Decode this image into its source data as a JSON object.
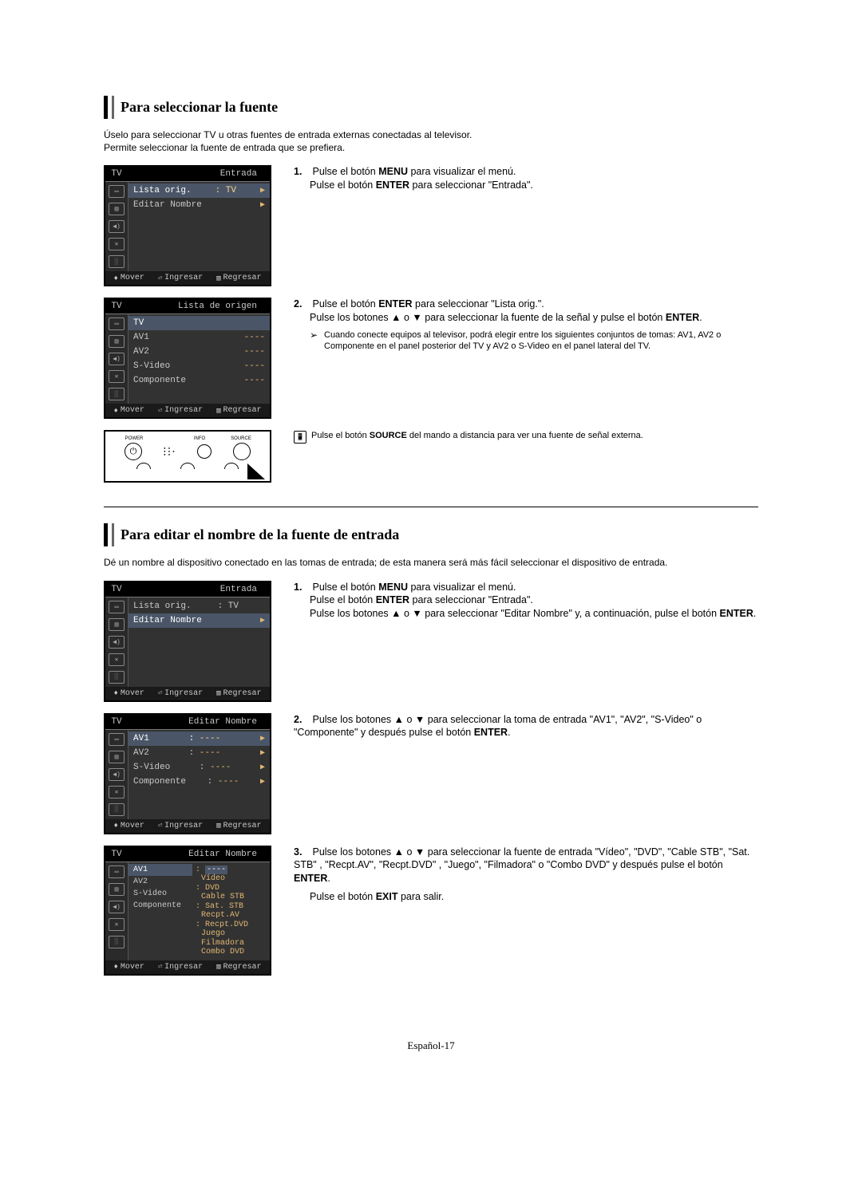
{
  "section1": {
    "title": "Para seleccionar la fuente",
    "intro_line1": "Úselo para seleccionar TV u otras fuentes de entrada externas conectadas al televisor.",
    "intro_line2": "Permite seleccionar la fuente de entrada que se prefiera."
  },
  "osd1": {
    "tv": "TV",
    "header_title": "Entrada",
    "row1_label": "Lista orig.",
    "row1_value": ": TV",
    "row2_label": "Editar Nombre",
    "footer_mover": "Mover",
    "footer_ingresar": "Ingresar",
    "footer_regresar": "Regresar"
  },
  "step1_1": {
    "num": "1.",
    "line_a_pre": "Pulse el botón ",
    "line_a_bold": "MENU",
    "line_a_post": " para visualizar el menú.",
    "line_b_pre": "Pulse el botón ",
    "line_b_bold": "ENTER",
    "line_b_post": " para seleccionar \"Entrada\"."
  },
  "osd2": {
    "tv": "TV",
    "header_title": "Lista de origen",
    "row1": "TV",
    "row2": "AV1",
    "row3": "AV2",
    "row4": "S-Video",
    "row5": "Componente",
    "dashes": "----",
    "footer_mover": "Mover",
    "footer_ingresar": "Ingresar",
    "footer_regresar": "Regresar"
  },
  "step1_2": {
    "num": "2.",
    "line_a_pre": "Pulse el botón ",
    "line_a_bold": "ENTER",
    "line_a_post": " para seleccionar \"Lista orig.\".",
    "line_b_pre": "Pulse los botones ▲ o ▼ para seleccionar la fuente de la señal y pulse el botón ",
    "line_b_bold": "ENTER",
    "line_b_post": ".",
    "note_icon": "➢",
    "note_text": "Cuando conecte equipos al televisor, podrá elegir entre los siguientes conjuntos de tomas: AV1, AV2 o Componente en el panel posterior del TV y AV2 o S-Video en el panel lateral del TV."
  },
  "remote_labels": {
    "power": "POWER",
    "info": "INFO",
    "source": "SOURCE"
  },
  "remote_note": {
    "pre": "Pulse el botón ",
    "bold": "SOURCE",
    "post": " del mando a distancia para ver una fuente de señal externa."
  },
  "section2": {
    "title": "Para editar el nombre de la fuente de entrada",
    "intro": "Dé un nombre al dispositivo conectado en las tomas de entrada; de esta manera será más fácil seleccionar el dispositivo de entrada."
  },
  "osd3": {
    "tv": "TV",
    "header_title": "Entrada",
    "row1_label": "Lista orig.",
    "row1_value": ": TV",
    "row2_label": "Editar Nombre",
    "footer_mover": "Mover",
    "footer_ingresar": "Ingresar",
    "footer_regresar": "Regresar"
  },
  "step2_1": {
    "num": "1.",
    "line_a_pre": "Pulse el botón ",
    "line_a_bold": "MENU",
    "line_a_post": " para visualizar el menú.",
    "line_b_pre": "Pulse el botón ",
    "line_b_bold": "ENTER",
    "line_b_post": " para seleccionar \"Entrada\".",
    "line_c_pre": "Pulse los botones ▲ o ▼ para seleccionar \"Editar Nombre\" y, a continuación, pulse el botón ",
    "line_c_bold": "ENTER",
    "line_c_post": "."
  },
  "osd4": {
    "tv": "TV",
    "header_title": "Editar Nombre",
    "row1": "AV1",
    "row2": "AV2",
    "row3": "S-Video",
    "row4": "Componente",
    "colon": ":",
    "dashes": "----",
    "footer_mover": "Mover",
    "footer_ingresar": "Ingresar",
    "footer_regresar": "Regresar"
  },
  "step2_2": {
    "num": "2.",
    "line_a_pre": "Pulse los botones ▲ o ▼ para seleccionar la toma de entrada \"AV1\", \"AV2\", \"S-Video\" o \"Componente\" y después pulse el botón ",
    "line_a_bold": "ENTER",
    "line_a_post": "."
  },
  "osd5": {
    "tv": "TV",
    "header_title": "Editar Nombre",
    "row1": "AV1",
    "row2": "AV2",
    "row3": "S-Video",
    "row4": "Componente",
    "colon": ":",
    "opt_dashes": "----",
    "opt_video": "Vídeo",
    "opt_dvd": "DVD",
    "opt_cable": "Cable STB",
    "opt_sat": "Sat. STB",
    "opt_recptav": "Recpt.AV",
    "opt_recptdvd": "Recpt.DVD",
    "opt_juego": "Juego",
    "opt_film": "Filmadora",
    "opt_combo": "Combo DVD",
    "footer_mover": "Mover",
    "footer_ingresar": "Ingresar",
    "footer_regresar": "Regresar"
  },
  "step2_3": {
    "num": "3.",
    "line_a_pre": "Pulse los botones ▲ o ▼ para seleccionar la fuente de entrada \"Vídeo\", \"DVD\", \"Cable STB\", \"Sat. STB\" , \"Recpt.AV\", \"Recpt.DVD\" , \"Juego\", \"Filmadora\" o \"Combo DVD\" y después pulse el botón ",
    "line_a_bold": "ENTER",
    "line_a_post": ".",
    "line_b_pre": "Pulse el botón ",
    "line_b_bold": "EXIT",
    "line_b_post": " para salir."
  },
  "footer": "Español-17"
}
